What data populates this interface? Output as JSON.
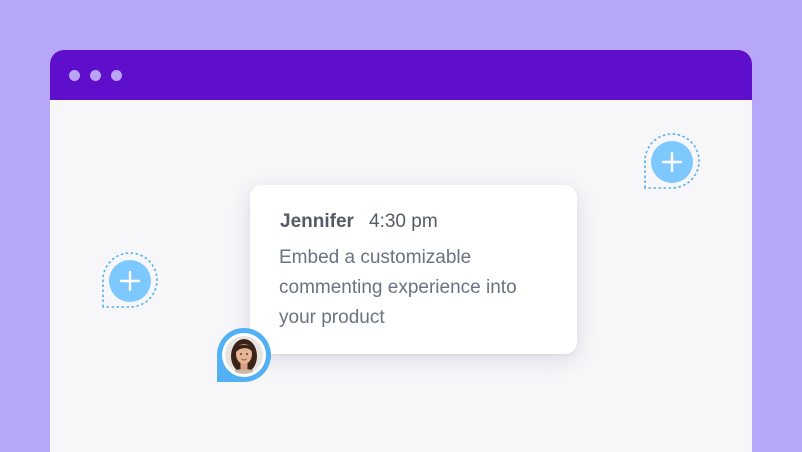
{
  "window": {
    "titlebar_color": "#5f0fcc",
    "controls": [
      "dot",
      "dot",
      "dot"
    ]
  },
  "comment_pins": [
    {
      "icon": "plus-icon",
      "color": "#7dc8ff"
    },
    {
      "icon": "plus-icon",
      "color": "#7dc8ff"
    }
  ],
  "comment": {
    "author": "Jennifer",
    "time": "4:30 pm",
    "message": "Embed a customizable commenting experience into your product",
    "avatar": "user-avatar-photo"
  },
  "colors": {
    "background": "#b7a7fb",
    "canvas": "#f7f7f9",
    "pin_blue": "#7dc8ff",
    "avatar_ring": "#52b1f5"
  }
}
